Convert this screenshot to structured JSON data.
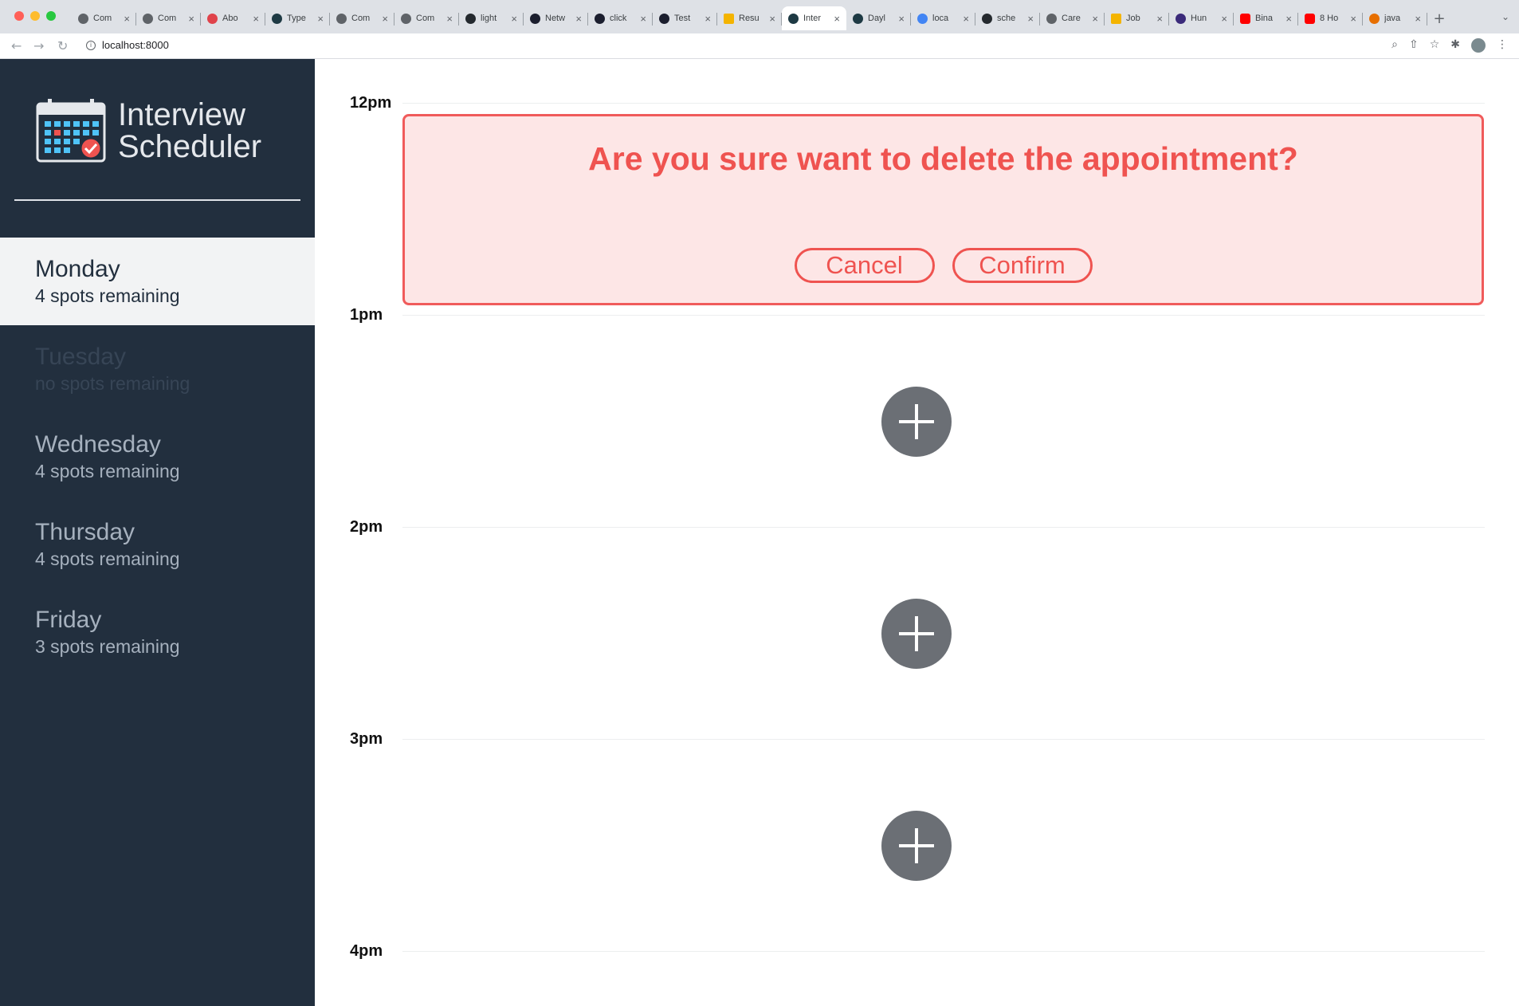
{
  "browser": {
    "tabs": [
      {
        "title": "Com"
      },
      {
        "title": "Com"
      },
      {
        "title": "Abo"
      },
      {
        "title": "Type"
      },
      {
        "title": "Com"
      },
      {
        "title": "Com"
      },
      {
        "title": "light"
      },
      {
        "title": "Netw"
      },
      {
        "title": "click"
      },
      {
        "title": "Test"
      },
      {
        "title": "Resu"
      },
      {
        "title": "Inter"
      },
      {
        "title": "Dayl"
      },
      {
        "title": "loca"
      },
      {
        "title": "sche"
      },
      {
        "title": "Care"
      },
      {
        "title": "Job"
      },
      {
        "title": "Hun"
      },
      {
        "title": "Bina"
      },
      {
        "title": "8 Ho"
      },
      {
        "title": "java"
      }
    ],
    "url": "localhost:8000"
  },
  "sidebar": {
    "brand_line1": "Interview",
    "brand_line2": "Scheduler",
    "days": [
      {
        "name": "Monday",
        "spots": "4 spots remaining"
      },
      {
        "name": "Tuesday",
        "spots": "no spots remaining"
      },
      {
        "name": "Wednesday",
        "spots": "4 spots remaining"
      },
      {
        "name": "Thursday",
        "spots": "4 spots remaining"
      },
      {
        "name": "Friday",
        "spots": "3 spots remaining"
      }
    ]
  },
  "schedule": {
    "hours": [
      "12pm",
      "1pm",
      "2pm",
      "3pm",
      "4pm"
    ],
    "confirm": {
      "message": "Are you sure want to delete the appointment?",
      "cancel_label": "Cancel",
      "confirm_label": "Confirm"
    }
  },
  "colors": {
    "sidebar_bg": "#222f3e",
    "danger": "#ef5350",
    "danger_bg": "#fde6e6",
    "add_button": "#6b6f75"
  }
}
